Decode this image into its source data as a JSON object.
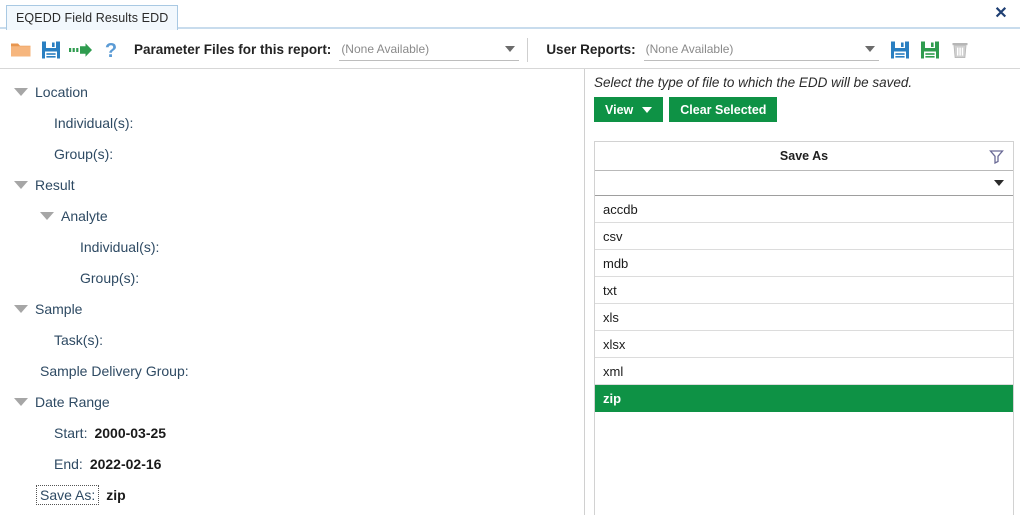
{
  "window": {
    "tab_label": "EQEDD Field Results EDD",
    "close_label": "✕"
  },
  "toolbar": {
    "open_icon": "folder-open-icon",
    "save_icon": "save-icon",
    "run_icon": "run-arrow-icon",
    "help_icon": "help-question-icon",
    "parameter_files_label": "Parameter Files for this report:",
    "parameter_files_value": "(None Available)",
    "user_reports_label": "User Reports:",
    "user_reports_value": "(None Available)",
    "save_report_icon": "save-blue-icon",
    "save_as_report_icon": "save-green-icon",
    "delete_report_icon": "trash-icon"
  },
  "tree": {
    "nodes": [
      {
        "label": "Location",
        "value": "",
        "level": 0,
        "expandable": true
      },
      {
        "label": "Individual(s):",
        "value": "",
        "level": 2,
        "expandable": false
      },
      {
        "label": "Group(s):",
        "value": "",
        "level": 2,
        "expandable": false
      },
      {
        "label": "Result",
        "value": "",
        "level": 0,
        "expandable": true
      },
      {
        "label": "Analyte",
        "value": "",
        "level": 1,
        "expandable": true
      },
      {
        "label": "Individual(s):",
        "value": "",
        "level": 3,
        "expandable": false
      },
      {
        "label": "Group(s):",
        "value": "",
        "level": 3,
        "expandable": false
      },
      {
        "label": "Sample",
        "value": "",
        "level": 0,
        "expandable": true
      },
      {
        "label": "Task(s):",
        "value": "",
        "level": 2,
        "expandable": false
      },
      {
        "label": "Sample Delivery Group:",
        "value": "",
        "level": 1,
        "expandable": false
      },
      {
        "label": "Date Range",
        "value": "",
        "level": 0,
        "expandable": true
      },
      {
        "label": "Start:",
        "value": "2000-03-25",
        "level": 2,
        "expandable": false
      },
      {
        "label": "End:",
        "value": "2022-02-16",
        "level": 2,
        "expandable": false
      },
      {
        "label": "Save As:",
        "value": "zip",
        "level": 1,
        "expandable": false,
        "focused": true
      }
    ]
  },
  "detail": {
    "hint": "Select the type of file to which the EDD will be saved.",
    "view_button": "View",
    "clear_button": "Clear Selected",
    "column_header": "Save As",
    "filter_icon": "funnel-filter-icon",
    "rows": [
      {
        "label": "accdb",
        "selected": false
      },
      {
        "label": "csv",
        "selected": false
      },
      {
        "label": "mdb",
        "selected": false
      },
      {
        "label": "txt",
        "selected": false
      },
      {
        "label": "xls",
        "selected": false
      },
      {
        "label": "xlsx",
        "selected": false
      },
      {
        "label": "xml",
        "selected": false
      },
      {
        "label": "zip",
        "selected": true
      }
    ]
  },
  "colors": {
    "accent_green": "#0e9245",
    "tab_border": "#a9c9e3",
    "link_text": "#2e4a63"
  }
}
